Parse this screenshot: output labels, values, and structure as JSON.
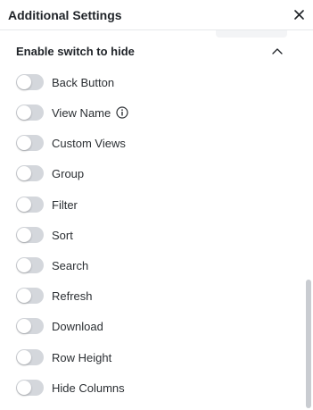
{
  "header": {
    "title": "Additional Settings",
    "close_icon": "close-icon"
  },
  "section": {
    "title": "Enable switch to hide",
    "toggle_icon": "chevron-up-icon"
  },
  "settings": [
    {
      "label": "Back Button",
      "enabled": false
    },
    {
      "label": "View Name",
      "enabled": false,
      "has_info": true
    },
    {
      "label": "Custom Views",
      "enabled": false
    },
    {
      "label": "Group",
      "enabled": false
    },
    {
      "label": "Filter",
      "enabled": false
    },
    {
      "label": "Sort",
      "enabled": false
    },
    {
      "label": "Search",
      "enabled": false
    },
    {
      "label": "Refresh",
      "enabled": false
    },
    {
      "label": "Download",
      "enabled": false
    },
    {
      "label": "Row Height",
      "enabled": false
    },
    {
      "label": "Hide Columns",
      "enabled": false
    }
  ],
  "colors": {
    "toggle_off": "#d4d7dc",
    "text": "#1f2328"
  }
}
